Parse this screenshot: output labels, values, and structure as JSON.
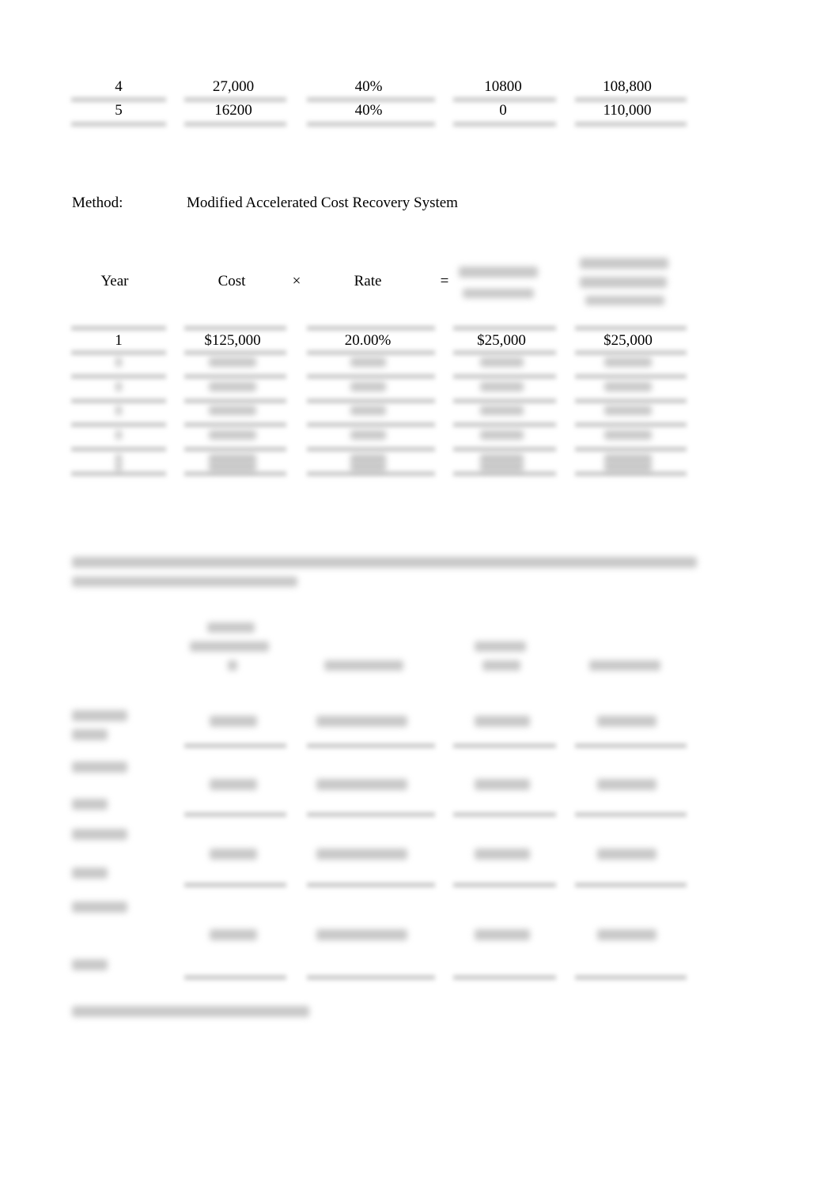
{
  "top_table": {
    "rows": [
      {
        "year": "4",
        "cost": "27,000",
        "rate": "40%",
        "depreciation": "10800",
        "accumulated": "108,800"
      },
      {
        "year": "5",
        "cost": "16200",
        "rate": "40%",
        "depreciation": "0",
        "accumulated": "110,000"
      }
    ]
  },
  "method": {
    "label": "Method:",
    "value": "Modified Accelerated Cost Recovery System"
  },
  "macrs_table": {
    "headers": {
      "year": "Year",
      "cost": "Cost",
      "times": "×",
      "rate": "Rate",
      "equals": "="
    },
    "rows": [
      {
        "year": "1",
        "cost": "$125,000",
        "rate": "20.00%",
        "depreciation": "$25,000",
        "accumulated": "$25,000"
      }
    ]
  }
}
